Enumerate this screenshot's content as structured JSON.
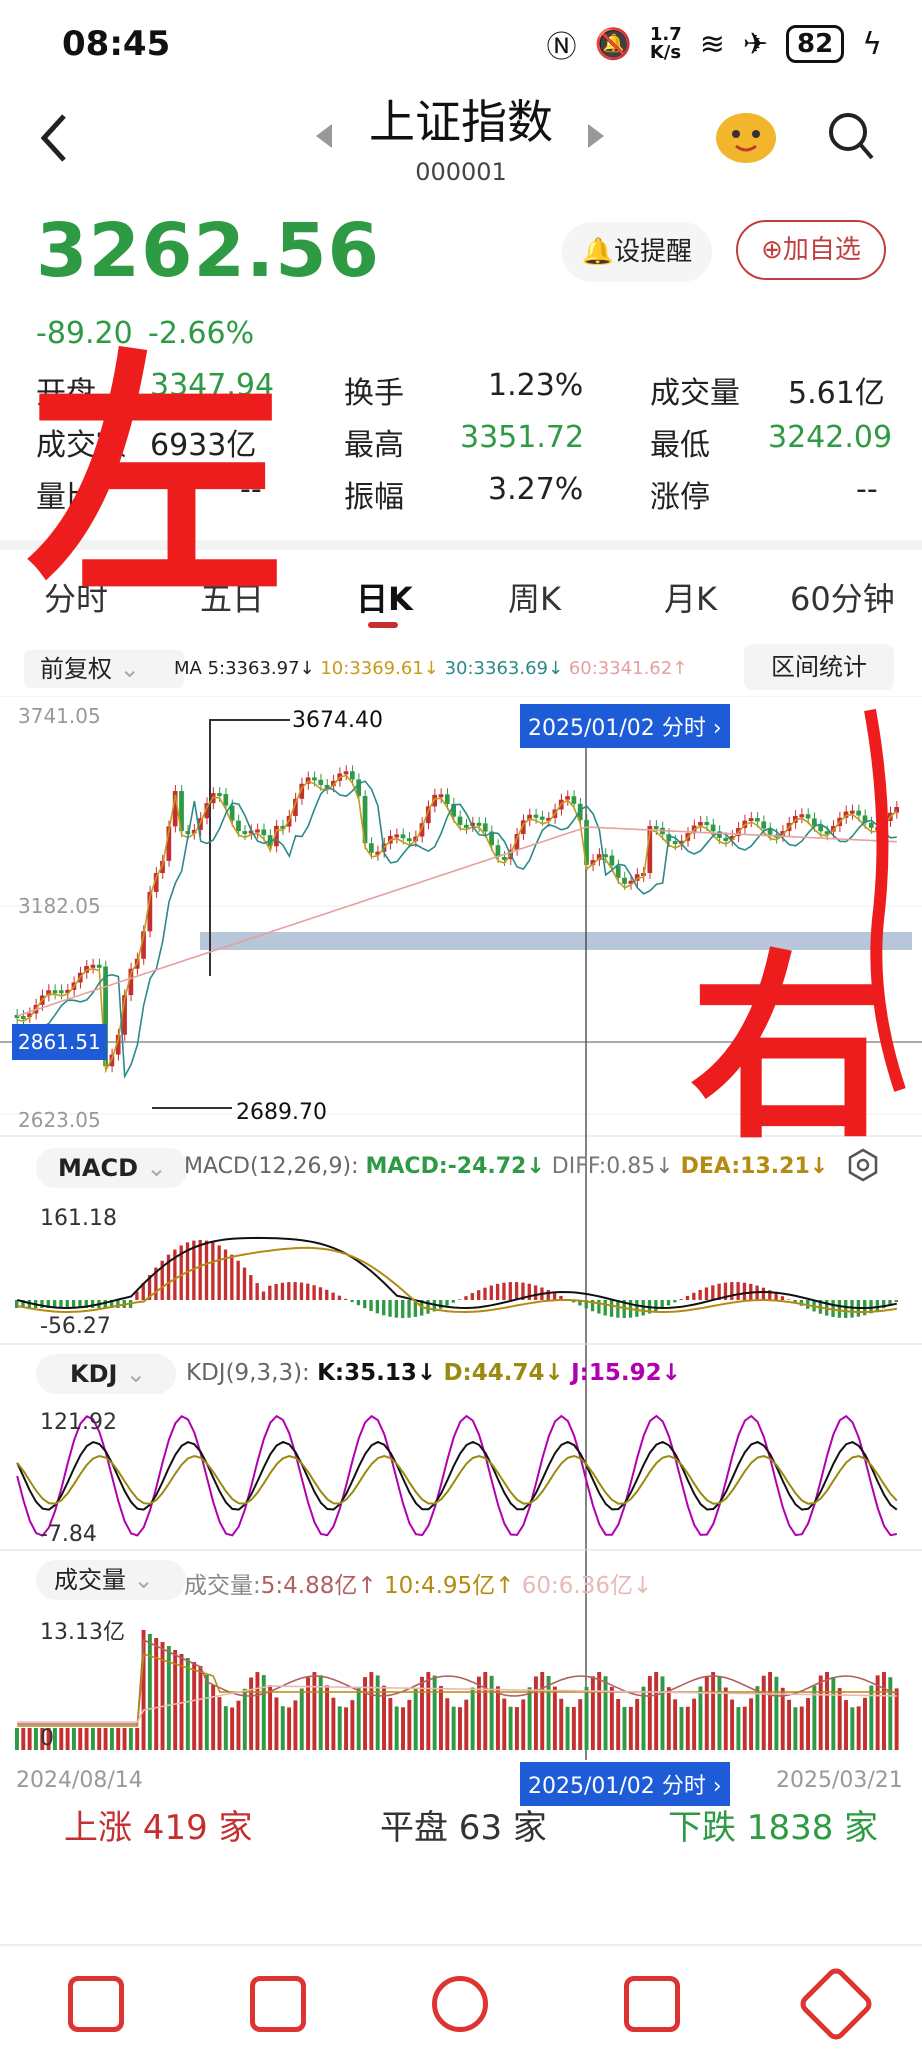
{
  "status": {
    "time": "08:45",
    "speed": "1.7\nK/s",
    "battery": "82"
  },
  "header": {
    "title": "上证指数",
    "code": "000001"
  },
  "quote": {
    "price": "3262.56",
    "change": "-89.20",
    "change_pct": "-2.66%"
  },
  "actions": {
    "alert": "设提醒",
    "add": "加自选"
  },
  "stats": [
    {
      "label": "开盘",
      "value": "3347.94"
    },
    {
      "label": "换手",
      "value": "1.23%"
    },
    {
      "label": "成交量",
      "value": "5.61亿"
    },
    {
      "label": "成交额",
      "value": "6933亿"
    },
    {
      "label": "最高",
      "value": "3351.72"
    },
    {
      "label": "最低",
      "value": "3242.09"
    },
    {
      "label": "量比",
      "value": "--"
    },
    {
      "label": "振幅",
      "value": "3.27%"
    },
    {
      "label": "涨停",
      "value": "--"
    }
  ],
  "tabs": [
    "分时",
    "五日",
    "日K",
    "周K",
    "月K",
    "60分钟"
  ],
  "kline": {
    "adjust": "前复权",
    "ma_text": [
      "MA 5:3363.97↓",
      "10:3369.61↓",
      "30:3363.69↓",
      "60:3341.62↑"
    ],
    "range_btn": "区间统计",
    "y_top": "3741.05",
    "y_mid": "3182.05",
    "y_bottom": "2623.05",
    "cursor_price": "2861.51",
    "high_mark": "3674.40",
    "low_mark": "2689.70",
    "cursor_date": "2025/01/02",
    "minute": "分时"
  },
  "macd": {
    "name": "MACD",
    "params": "MACD(12,26,9):",
    "macd": "MACD:-24.72↓",
    "diff": "DIFF:0.85↓",
    "dea": "DEA:13.21↓",
    "top": "161.18",
    "bottom": "-56.27"
  },
  "kdj": {
    "name": "KDJ",
    "params": "KDJ(9,3,3):",
    "k": "K:35.13↓",
    "d": "D:44.74↓",
    "j": "J:15.92↓",
    "top": "121.92",
    "bottom": "-7.84"
  },
  "volume": {
    "name": "成交量",
    "label": "成交量:",
    "v5": "5:4.88亿↑",
    "v10": "10:4.95亿↑",
    "v60": "60:6.36亿↓",
    "top": "13.13亿",
    "zero": "0"
  },
  "dates": {
    "start": "2024/08/14",
    "end": "2025/03/21"
  },
  "breadth": {
    "up": "上涨 419 家",
    "flat": "平盘 63 家",
    "down": "下跌 1838 家"
  },
  "graffiti": {
    "left": "左",
    "right": "右"
  },
  "colors": {
    "green": "#2e9a44",
    "red": "#c62f2f",
    "blue": "#1e5bd6",
    "orange": "#c79a1c",
    "purple": "#b000b0"
  }
}
